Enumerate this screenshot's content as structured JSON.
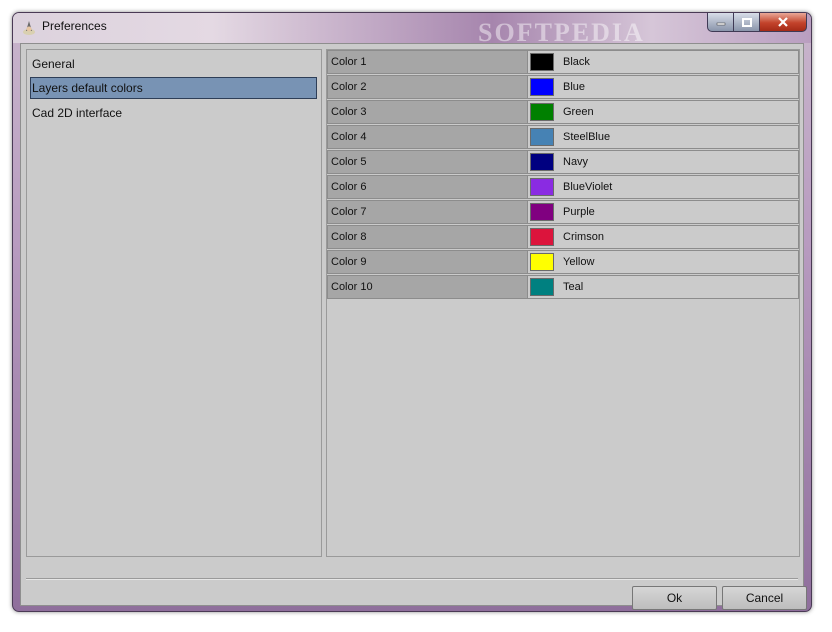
{
  "window": {
    "title": "Preferences",
    "watermark": "SOFTPEDIA"
  },
  "nav": {
    "items": [
      {
        "label": "General",
        "selected": false
      },
      {
        "label": "Layers default colors",
        "selected": true
      },
      {
        "label": "Cad 2D interface",
        "selected": false
      }
    ]
  },
  "colors": [
    {
      "label": "Color 1",
      "name": "Black",
      "hex": "#000000"
    },
    {
      "label": "Color 2",
      "name": "Blue",
      "hex": "#0000ff"
    },
    {
      "label": "Color 3",
      "name": "Green",
      "hex": "#008000"
    },
    {
      "label": "Color 4",
      "name": "SteelBlue",
      "hex": "#4682b4"
    },
    {
      "label": "Color 5",
      "name": "Navy",
      "hex": "#000080"
    },
    {
      "label": "Color 6",
      "name": "BlueViolet",
      "hex": "#8a2be2"
    },
    {
      "label": "Color 7",
      "name": "Purple",
      "hex": "#800080"
    },
    {
      "label": "Color 8",
      "name": "Crimson",
      "hex": "#dc143c"
    },
    {
      "label": "Color 9",
      "name": "Yellow",
      "hex": "#ffff00"
    },
    {
      "label": "Color 10",
      "name": "Teal",
      "hex": "#008080"
    }
  ],
  "footer": {
    "ok_label": "Ok",
    "cancel_label": "Cancel"
  },
  "theme": {
    "selection": "#7893b4",
    "close_button": "#c3432b"
  },
  "icons": {
    "app": "gnome-icon",
    "minimize": "minimize-icon",
    "maximize": "maximize-icon",
    "close": "close-icon"
  }
}
